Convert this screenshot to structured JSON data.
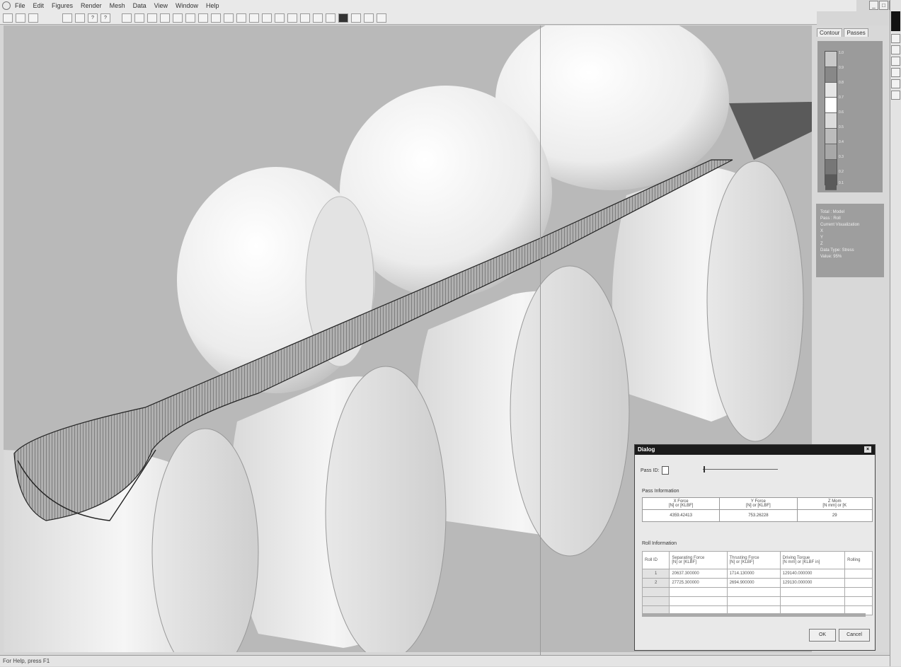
{
  "menu": {
    "items": [
      "File",
      "Edit",
      "Figures",
      "Render",
      "Mesh",
      "Data",
      "View",
      "Window",
      "Help"
    ],
    "window_buttons": [
      "_",
      "□",
      "×"
    ]
  },
  "toolbar": {
    "icons": [
      "new-icon",
      "open-icon",
      "save-icon",
      "print-icon",
      "help-icon",
      "rotate-icon",
      "pan-icon",
      "zoom-icon",
      "fit-icon",
      "select-icon",
      "light-icon",
      "color-icon"
    ]
  },
  "side_panel": {
    "tabs": [
      "Contour",
      "Passes"
    ],
    "legend_labels": [
      "1.0",
      "0.9",
      "0.8",
      "0.7",
      "0.6",
      "0.5",
      "0.4",
      "0.3",
      "0.2",
      "0.1"
    ],
    "info_lines": [
      "Total : Model",
      "Pass : Roll",
      "Current Visualization",
      "  X",
      "  Y",
      "  Z",
      "Data Type: Stress",
      "  Value: 95%"
    ]
  },
  "dialog": {
    "title": "Dialog",
    "close_label": "×",
    "pass_id_label": "Pass ID:",
    "pass_info_label": "Pass Information",
    "pass_headers": [
      "X Force\n[N] or [KLBF]",
      "Y Force\n[N] or [KLBF]",
      "Z Mom\n[N mm] or [K"
    ],
    "pass_values": [
      "4359.42413",
      "753.26228",
      "29"
    ],
    "roll_info_label": "Roll Information",
    "roll_headers": [
      "Roll ID",
      "Separating Force\n[N] or [KLBF]",
      "Thrusting Force\n[N] or [KLBF]",
      "Driving Torque\n[N mm] or [KLBF in]",
      "Rolling"
    ],
    "roll_rows": [
      [
        "1",
        "20637.300000",
        "1714.130000",
        "129140.000000",
        ""
      ],
      [
        "2",
        "27725.300000",
        "2694.900000",
        "129130.000000",
        ""
      ]
    ],
    "ok_label": "OK",
    "cancel_label": "Cancel"
  },
  "statusbar": {
    "text": "For Help, press F1"
  }
}
